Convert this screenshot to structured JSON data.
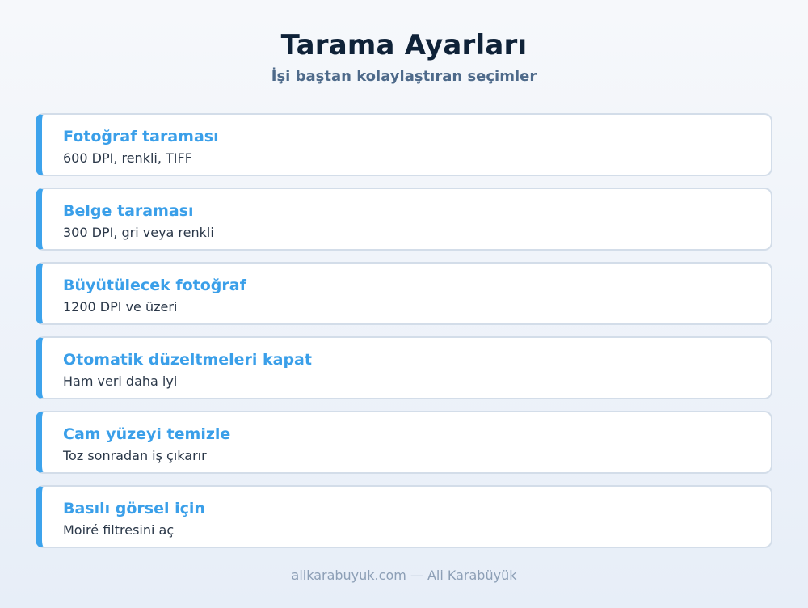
{
  "header": {
    "title": "Tarama Ayarları",
    "subtitle": "İşi baştan kolaylaştıran seçimler"
  },
  "items": [
    {
      "title": "Fotoğraf taraması",
      "description": "600 DPI, renkli, TIFF"
    },
    {
      "title": "Belge taraması",
      "description": "300 DPI, gri veya renkli"
    },
    {
      "title": "Büyütülecek fotoğraf",
      "description": "1200 DPI ve üzeri"
    },
    {
      "title": "Otomatik düzeltmeleri kapat",
      "description": "Ham veri daha iyi"
    },
    {
      "title": "Cam yüzeyi temizle",
      "description": "Toz sonradan iş çıkarır"
    },
    {
      "title": "Basılı görsel için",
      "description": "Moiré filtresini aç"
    }
  ],
  "footer": {
    "credit": "alikarabuyuk.com — Ali Karabüyük"
  },
  "colors": {
    "accent": "#3da3ec",
    "title": "#0f2238",
    "subtitle": "#4e6a8a",
    "footer": "#8d9fb6"
  }
}
